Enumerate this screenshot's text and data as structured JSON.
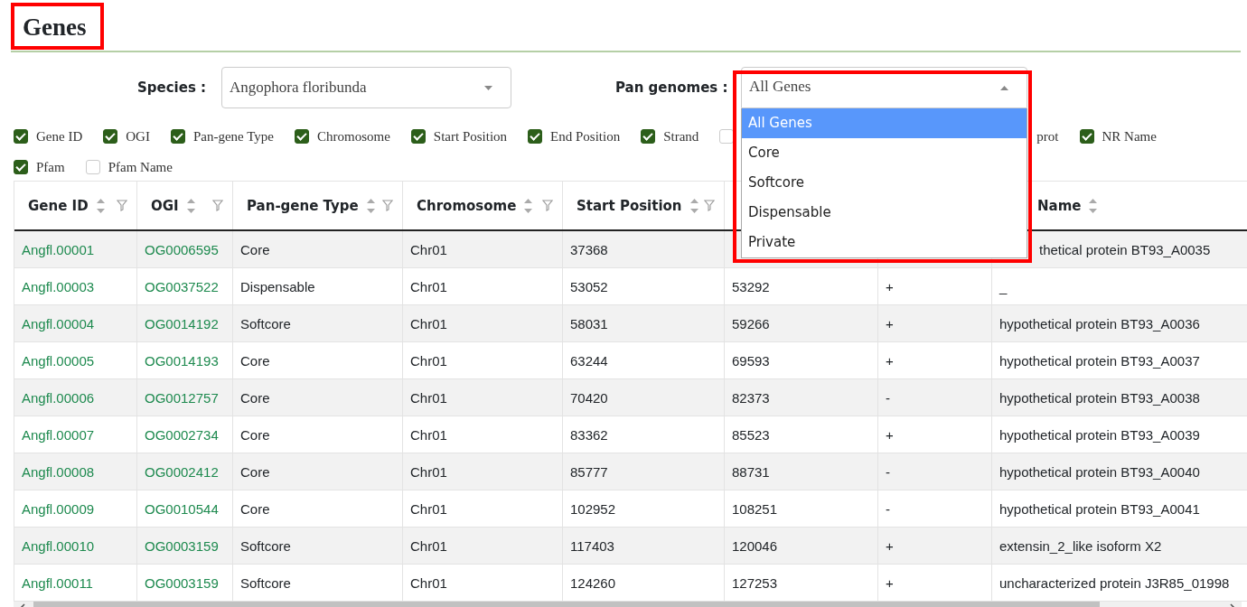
{
  "title": "Genes",
  "filters": {
    "species": {
      "label": "Species :",
      "value": "Angophora floribunda"
    },
    "pan_genomes": {
      "label": "Pan genomes :",
      "value": "All Genes",
      "expanded": true,
      "options": [
        {
          "label": "All Genes",
          "selected": true
        },
        {
          "label": "Core",
          "selected": false
        },
        {
          "label": "Softcore",
          "selected": false
        },
        {
          "label": "Dispensable",
          "selected": false
        },
        {
          "label": "Private",
          "selected": false
        }
      ]
    }
  },
  "column_toggles": [
    {
      "label": "Gene ID",
      "checked": true
    },
    {
      "label": "OGI",
      "checked": true
    },
    {
      "label": "Pan-gene Type",
      "checked": true
    },
    {
      "label": "Chromosome",
      "checked": true
    },
    {
      "label": "Start Position",
      "checked": true
    },
    {
      "label": "End Position",
      "checked": true
    },
    {
      "label": "Strand",
      "checked": true
    },
    {
      "checked": false
    },
    {
      "label": "prot"
    },
    {
      "label": "NR Name",
      "checked": true
    },
    {
      "label": "Pfam",
      "checked": true
    },
    {
      "label": "Pfam Name",
      "checked": false
    }
  ],
  "table": {
    "columns": [
      "Gene ID",
      "OGI",
      "Pan-gene Type",
      "Chromosome",
      "Start Position",
      "Name"
    ],
    "rows": [
      [
        "Angfl.00001",
        "OG0006595",
        "Core",
        "Chr01",
        "37368",
        "thetical protein BT93_A0035"
      ],
      [
        "Angfl.00003",
        "OG0037522",
        "Dispensable",
        "Chr01",
        "53052",
        "53292",
        "+",
        "_"
      ],
      [
        "Angfl.00004",
        "OG0014192",
        "Softcore",
        "Chr01",
        "58031",
        "59266",
        "+",
        "hypothetical protein BT93_A0036"
      ],
      [
        "Angfl.00005",
        "OG0014193",
        "Core",
        "Chr01",
        "63244",
        "69593",
        "+",
        "hypothetical protein BT93_A0037"
      ],
      [
        "Angfl.00006",
        "OG0012757",
        "Core",
        "Chr01",
        "70420",
        "82373",
        "-",
        "hypothetical protein BT93_A0038"
      ],
      [
        "Angfl.00007",
        "OG0002734",
        "Core",
        "Chr01",
        "83362",
        "85523",
        "+",
        "hypothetical protein BT93_A0039"
      ],
      [
        "Angfl.00008",
        "OG0002412",
        "Core",
        "Chr01",
        "85777",
        "88731",
        "-",
        "hypothetical protein BT93_A0040"
      ],
      [
        "Angfl.00009",
        "OG0010544",
        "Core",
        "Chr01",
        "102952",
        "108251",
        "-",
        "hypothetical protein BT93_A0041"
      ],
      [
        "Angfl.00010",
        "OG0003159",
        "Softcore",
        "Chr01",
        "117403",
        "120046",
        "+",
        "extensin_2_like isoform X2"
      ],
      [
        "Angfl.00011",
        "OG0003159",
        "Softcore",
        "Chr01",
        "124260",
        "127253",
        "+",
        "uncharacterized protein J3R85_01998"
      ]
    ]
  }
}
